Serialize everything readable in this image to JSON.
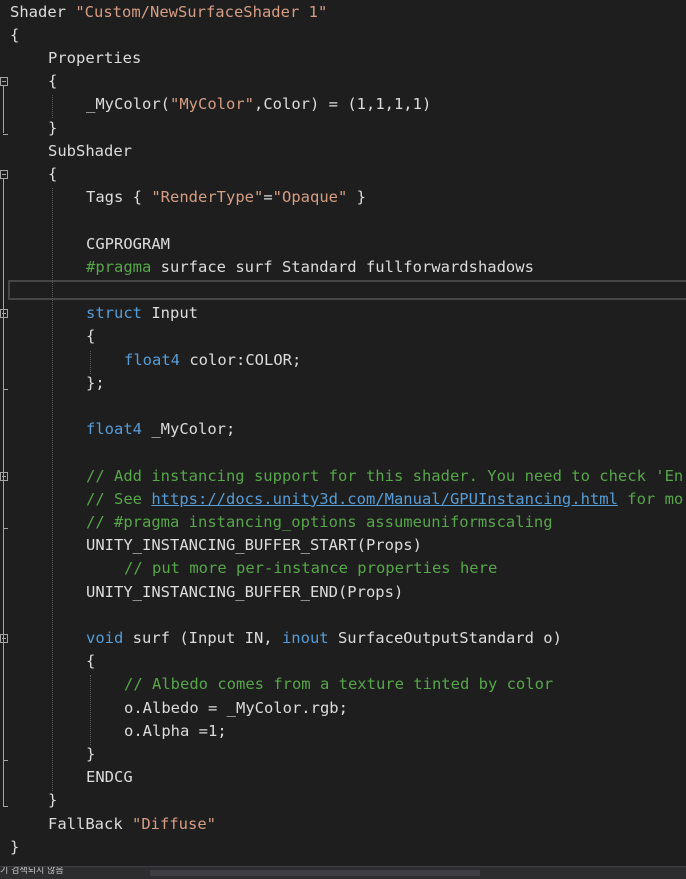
{
  "lines": [
    {
      "indent": 0,
      "tokens": [
        [
          "t",
          "Shader "
        ],
        [
          "s",
          "\"Custom/NewSurfaceShader 1\""
        ]
      ]
    },
    {
      "indent": 0,
      "tokens": [
        [
          "t",
          "{"
        ]
      ]
    },
    {
      "indent": 1,
      "tokens": [
        [
          "t",
          "Properties"
        ]
      ]
    },
    {
      "indent": 1,
      "tokens": [
        [
          "t",
          "{"
        ]
      ]
    },
    {
      "indent": 2,
      "tokens": [
        [
          "t",
          "_MyColor("
        ],
        [
          "s",
          "\"MyColor\""
        ],
        [
          "t",
          ",Color) = (1,1,1,1)"
        ]
      ]
    },
    {
      "indent": 1,
      "tokens": [
        [
          "t",
          "}"
        ]
      ]
    },
    {
      "indent": 1,
      "tokens": [
        [
          "t",
          "SubShader"
        ]
      ]
    },
    {
      "indent": 1,
      "tokens": [
        [
          "t",
          "{"
        ]
      ]
    },
    {
      "indent": 2,
      "tokens": [
        [
          "t",
          "Tags { "
        ],
        [
          "s",
          "\"RenderType\""
        ],
        [
          "t",
          "="
        ],
        [
          "s",
          "\"Opaque\""
        ],
        [
          "t",
          " }"
        ]
      ]
    },
    {
      "indent": 2,
      "tokens": []
    },
    {
      "indent": 2,
      "tokens": [
        [
          "t",
          "CGPROGRAM"
        ]
      ]
    },
    {
      "indent": 2,
      "tokens": [
        [
          "c",
          "#pragma"
        ],
        [
          "t",
          " surface surf Standard fullforwardshadows"
        ]
      ]
    },
    {
      "indent": 2,
      "tokens": []
    },
    {
      "indent": 2,
      "tokens": [
        [
          "k",
          "struct"
        ],
        [
          "t",
          " Input"
        ]
      ]
    },
    {
      "indent": 2,
      "tokens": [
        [
          "t",
          "{"
        ]
      ]
    },
    {
      "indent": 3,
      "tokens": [
        [
          "k",
          "float4"
        ],
        [
          "t",
          " color:COLOR;"
        ]
      ]
    },
    {
      "indent": 2,
      "tokens": [
        [
          "t",
          "};"
        ]
      ]
    },
    {
      "indent": 2,
      "tokens": []
    },
    {
      "indent": 2,
      "tokens": [
        [
          "k",
          "float4"
        ],
        [
          "t",
          " _MyColor;"
        ]
      ]
    },
    {
      "indent": 2,
      "tokens": []
    },
    {
      "indent": 2,
      "tokens": [
        [
          "g",
          "// Add instancing support for this shader. You need to check 'En"
        ]
      ]
    },
    {
      "indent": 2,
      "tokens": [
        [
          "g",
          "// See "
        ],
        [
          "l",
          "https://docs.unity3d.com/Manual/GPUInstancing.html"
        ],
        [
          "g",
          " for mo"
        ]
      ]
    },
    {
      "indent": 2,
      "tokens": [
        [
          "g",
          "// #pragma instancing_options assumeuniformscaling"
        ]
      ]
    },
    {
      "indent": 2,
      "tokens": [
        [
          "t",
          "UNITY_INSTANCING_BUFFER_START(Props)"
        ]
      ]
    },
    {
      "indent": 3,
      "tokens": [
        [
          "g",
          "// put more per-instance properties here"
        ]
      ]
    },
    {
      "indent": 2,
      "tokens": [
        [
          "t",
          "UNITY_INSTANCING_BUFFER_END(Props)"
        ]
      ]
    },
    {
      "indent": 2,
      "tokens": []
    },
    {
      "indent": 2,
      "tokens": [
        [
          "k",
          "void"
        ],
        [
          "t",
          " surf (Input IN, "
        ],
        [
          "k",
          "inout"
        ],
        [
          "t",
          " SurfaceOutputStandard o)"
        ]
      ]
    },
    {
      "indent": 2,
      "tokens": [
        [
          "t",
          "{"
        ]
      ]
    },
    {
      "indent": 3,
      "tokens": [
        [
          "g",
          "// Albedo comes from a texture tinted by color"
        ]
      ]
    },
    {
      "indent": 3,
      "tokens": [
        [
          "t",
          "o.Albedo = _MyColor.rgb;"
        ]
      ]
    },
    {
      "indent": 3,
      "tokens": [
        [
          "t",
          "o.Alpha =1;"
        ]
      ]
    },
    {
      "indent": 2,
      "tokens": [
        [
          "t",
          "}"
        ]
      ]
    },
    {
      "indent": 2,
      "tokens": [
        [
          "t",
          "ENDCG"
        ]
      ]
    },
    {
      "indent": 1,
      "tokens": [
        [
          "t",
          "}"
        ]
      ]
    },
    {
      "indent": 1,
      "tokens": [
        [
          "t",
          "FallBack "
        ],
        [
          "s",
          "\"Diffuse\""
        ]
      ]
    },
    {
      "indent": 0,
      "tokens": [
        [
          "t",
          "}"
        ]
      ]
    }
  ],
  "status": {
    "text": "기 검색되지 않음"
  },
  "colors": {
    "background": "#1e1e1e",
    "text": "#dcdcdc",
    "keyword": "#569cd6",
    "string": "#d69d85",
    "comment": "#57a64a"
  }
}
